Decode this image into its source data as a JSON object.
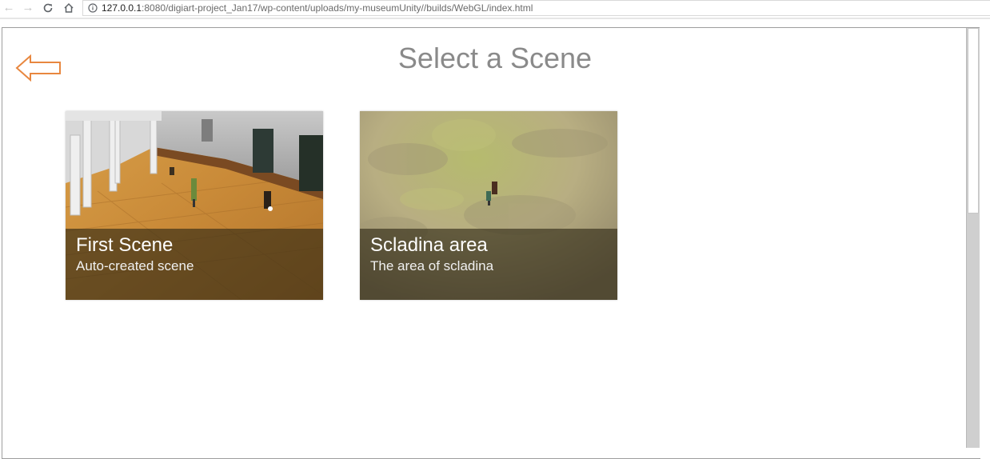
{
  "browser": {
    "url_host": "127.0.0.1",
    "url_rest": ":8080/digiart-project_Jan17/wp-content/uploads/my-museumUnity//builds/WebGL/index.html",
    "icons": {
      "back": "back-arrow-icon",
      "forward": "forward-arrow-icon",
      "reload": "reload-icon",
      "home": "home-icon",
      "info": "info-icon"
    }
  },
  "page": {
    "title": "Select a Scene",
    "back_icon": "back-arrow-icon",
    "accent_color": "#e8873f"
  },
  "scenes": [
    {
      "name": "First Scene",
      "description": "Auto-created scene"
    },
    {
      "name": "Scladina area",
      "description": "The area of scladina"
    }
  ]
}
